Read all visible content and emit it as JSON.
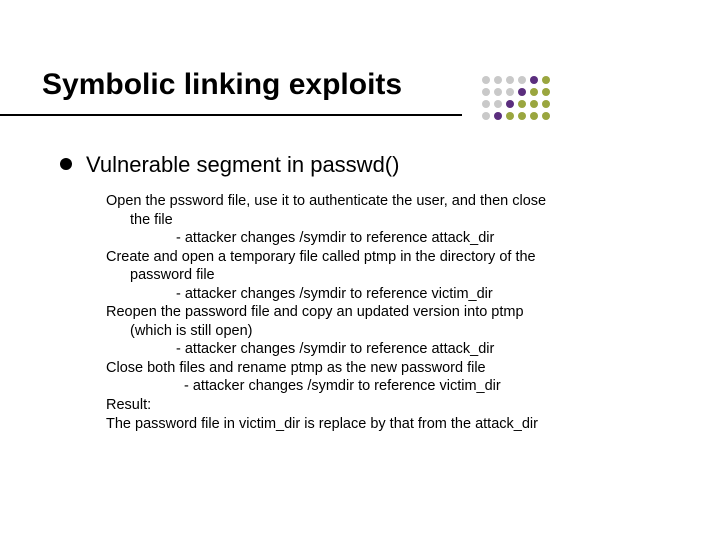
{
  "title": "Symbolic linking exploits",
  "bullet": "Vulnerable segment in passwd()",
  "lines": {
    "l0": "Open the pssword file, use it to authenticate the user, and then close",
    "l0b": "the file",
    "l1": "- attacker changes /symdir to reference attack_dir",
    "l2": "Create and open a temporary file called ptmp in the directory of the",
    "l2b": "password file",
    "l3": "- attacker changes /symdir to reference victim_dir",
    "l4": "Reopen the password file and copy an updated version into ptmp",
    "l4b": "(which is still open)",
    "l5": "- attacker changes /symdir to reference attack_dir",
    "l6": "Close both files and rename ptmp as the new password file",
    "l7": "- attacker changes /symdir to reference victim_dir",
    "l8": "Result:",
    "l9": "The password file in victim_dir is replace by that from the attack_dir"
  },
  "dots": {
    "colors": {
      "grey": "#c9c9c9",
      "purple": "#5b2e7e",
      "olive": "#9aa63f"
    }
  }
}
